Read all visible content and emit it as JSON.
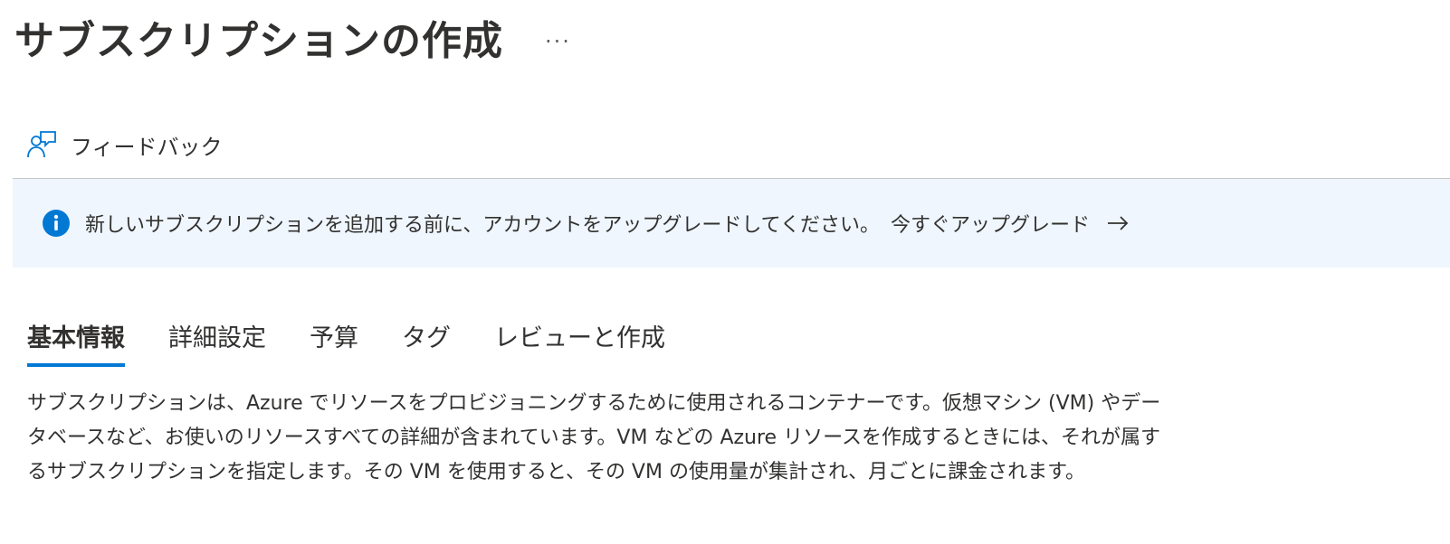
{
  "header": {
    "title": "サブスクリプションの作成",
    "more_label": "···"
  },
  "feedback": {
    "label": "フィードバック",
    "icon": "feedback-person-icon"
  },
  "banner": {
    "icon": "info-icon",
    "text": "新しいサブスクリプションを追加する前に、アカウントをアップグレードしてください。",
    "link_label": "今すぐアップグレード",
    "link_icon": "arrow-right-icon",
    "background": "#eff6fd",
    "icon_color": "#0078d4"
  },
  "tabs": [
    {
      "label": "基本情報",
      "active": true
    },
    {
      "label": "詳細設定",
      "active": false
    },
    {
      "label": "予算",
      "active": false
    },
    {
      "label": "タグ",
      "active": false
    },
    {
      "label": "レビューと作成",
      "active": false
    }
  ],
  "accent_color": "#0078d4",
  "description": {
    "line1": "サブスクリプションは、Azure でリソースをプロビジョニングするために使用されるコンテナーです。仮想マシン (VM) やデー",
    "line2": "タベースなど、お使いのリソースすべての詳細が含まれています。VM などの Azure リソースを作成するときには、それが属す",
    "line3": "るサブスクリプションを指定します。その VM を使用すると、その VM の使用量が集計され、月ごとに課金されます。"
  }
}
